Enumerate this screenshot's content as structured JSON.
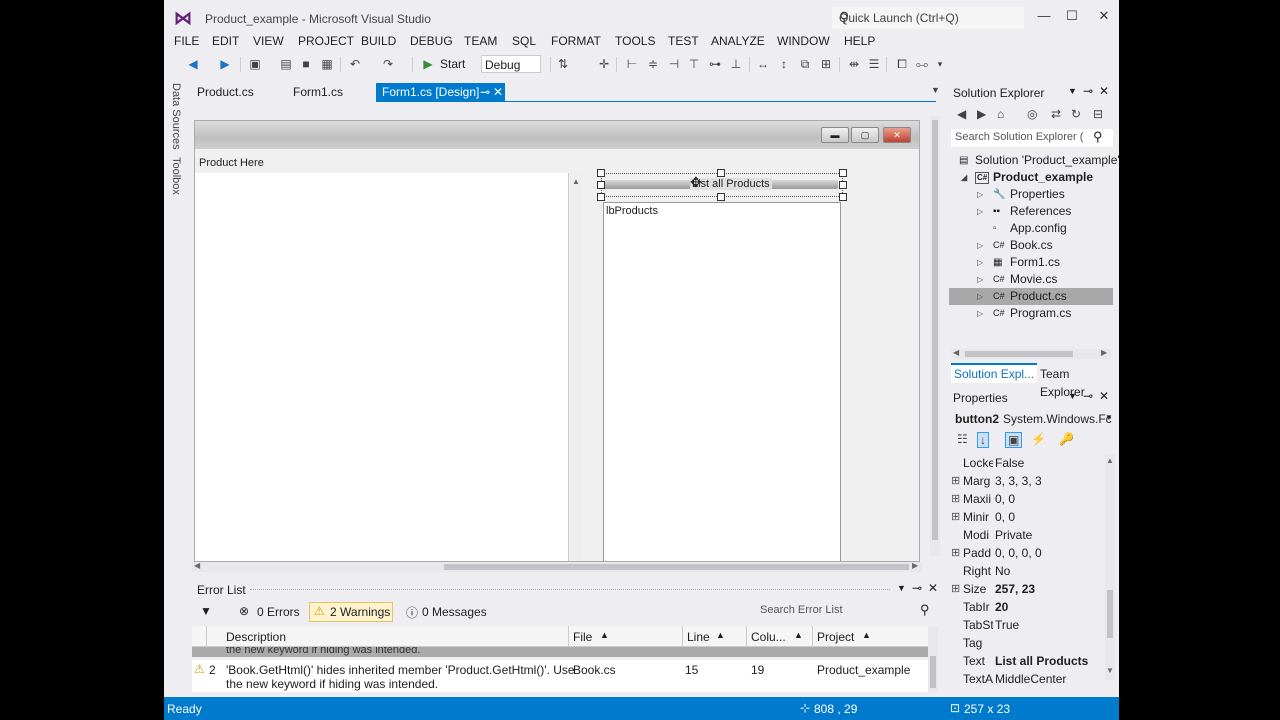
{
  "window": {
    "title": "Product_example - Microsoft Visual Studio",
    "quick_launch_placeholder": "Quick Launch (Ctrl+Q)",
    "min": "—",
    "max": "☐",
    "close": "✕"
  },
  "menu": [
    "FILE",
    "EDIT",
    "VIEW",
    "PROJECT",
    "BUILD",
    "DEBUG",
    "TEAM",
    "SQL",
    "FORMAT",
    "TOOLS",
    "TEST",
    "ANALYZE",
    "WINDOW",
    "HELP"
  ],
  "toolbar": {
    "start_label": "Start",
    "config_value": "Debug"
  },
  "side_tabs": {
    "data_sources": "Data Sources",
    "toolbox": "Toolbox"
  },
  "doc_tabs": [
    {
      "label": "Product.cs",
      "active": false
    },
    {
      "label": "Form1.cs",
      "active": false
    },
    {
      "label": "Form1.cs [Design]",
      "active": true
    }
  ],
  "designer": {
    "label_text": "Product Here",
    "button_text": "List all Products",
    "listbox_text": "lbProducts"
  },
  "solution_explorer": {
    "title": "Solution Explorer",
    "search_placeholder": "Search Solution Explorer (",
    "items": [
      {
        "label": "Solution 'Product_example'",
        "icon": "solution-icon",
        "level": 0
      },
      {
        "label": "Product_example",
        "icon": "csproj-icon",
        "level": 1
      },
      {
        "label": "Properties",
        "icon": "wrench-icon",
        "level": 2
      },
      {
        "label": "References",
        "icon": "references-icon",
        "level": 2
      },
      {
        "label": "App.config",
        "icon": "config-file-icon",
        "level": 2
      },
      {
        "label": "Book.cs",
        "icon": "csharp-file-icon",
        "level": 2
      },
      {
        "label": "Form1.cs",
        "icon": "form-file-icon",
        "level": 2
      },
      {
        "label": "Movie.cs",
        "icon": "csharp-file-icon",
        "level": 2
      },
      {
        "label": "Product.cs",
        "icon": "csharp-file-icon",
        "level": 2
      },
      {
        "label": "Program.cs",
        "icon": "csharp-file-icon",
        "level": 2
      }
    ],
    "tabs": [
      "Solution Expl...",
      "Team Explorer"
    ]
  },
  "properties": {
    "title": "Properties",
    "object": "button2",
    "object_type": "System.Windows.Fc",
    "rows": [
      {
        "expand": "",
        "name": "Locke",
        "value": "False",
        "bold": false
      },
      {
        "expand": "⊞",
        "name": "Marg",
        "value": "3, 3, 3, 3",
        "bold": false
      },
      {
        "expand": "⊞",
        "name": "Maxii",
        "value": "0, 0",
        "bold": false
      },
      {
        "expand": "⊞",
        "name": "Minir",
        "value": "0, 0",
        "bold": false
      },
      {
        "expand": "",
        "name": "Modi",
        "value": "Private",
        "bold": false
      },
      {
        "expand": "⊞",
        "name": "Padd",
        "value": "0, 0, 0, 0",
        "bold": false
      },
      {
        "expand": "",
        "name": "Right",
        "value": "No",
        "bold": false
      },
      {
        "expand": "⊞",
        "name": "Size",
        "value": "257, 23",
        "bold": true
      },
      {
        "expand": "",
        "name": "TabIr",
        "value": "20",
        "bold": true
      },
      {
        "expand": "",
        "name": "TabSt",
        "value": "True",
        "bold": false
      },
      {
        "expand": "",
        "name": "Tag",
        "value": "",
        "bold": false
      },
      {
        "expand": "",
        "name": "Text",
        "value": "List all Products",
        "bold": true
      },
      {
        "expand": "",
        "name": "TextA",
        "value": "MiddleCenter",
        "bold": false
      }
    ]
  },
  "error_list": {
    "title": "Error List",
    "errors": "0 Errors",
    "warnings": "2 Warnings",
    "messages": "0 Messages",
    "search_placeholder": "Search Error List",
    "columns": [
      "Description",
      "File",
      "Line",
      "Colu...",
      "Project"
    ],
    "overlap_text": "the new keyword if hiding was intended.",
    "rows": [
      {
        "num": "2",
        "description": "'Book.GetHtml()' hides inherited member 'Product.GetHtml()'. Use",
        "description2": "the new keyword if hiding was intended.",
        "file": "Book.cs",
        "line": "15",
        "column": "19",
        "project": "Product_example"
      }
    ]
  },
  "status": {
    "text": "Ready",
    "position": "808 , 29",
    "size": "257 x 23"
  }
}
